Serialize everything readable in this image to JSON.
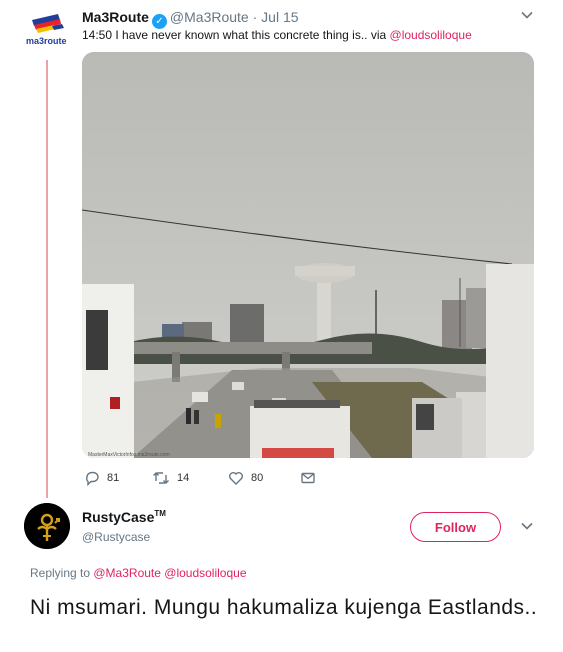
{
  "colors": {
    "accent": "#e0245e",
    "verified": "#1da1f2",
    "muted": "#657786",
    "thread": "#e9a3a6"
  },
  "tweet1": {
    "avatar_text": "ma3route",
    "name": "Ma3Route",
    "verified_icon": "check-icon",
    "handle": "@Ma3Route",
    "separator": "·",
    "date": "Jul 15",
    "text": "14:50 I have never known what this concrete thing is..  via ",
    "mention": "@loudsoliloque",
    "photo_watermark": "MasterMaxVictorInfos.ma3route.com",
    "counts": {
      "replies": "81",
      "retweets": "14",
      "likes": "80"
    }
  },
  "tweet2": {
    "name": "RustyCase",
    "name_mark": "TM",
    "handle": "@Rustycase",
    "follow_label": "Follow",
    "replying_prefix": "Replying to ",
    "replying_to": "@Ma3Route @loudsoliloque",
    "text": "Ni msumari. Mungu hakumaliza kujenga Eastlands.."
  }
}
